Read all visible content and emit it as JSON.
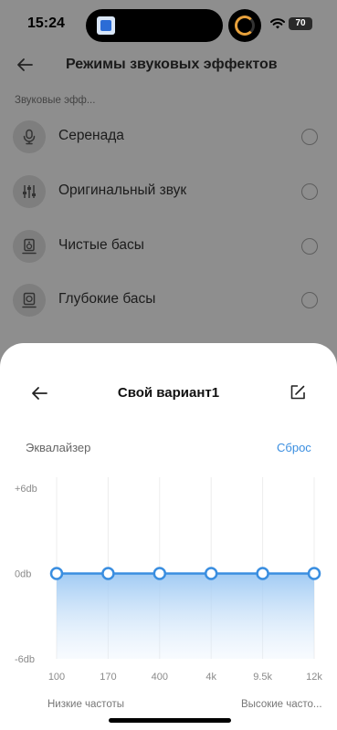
{
  "status_bar": {
    "time": "15:24",
    "battery": "70"
  },
  "header": {
    "title": "Режимы звуковых эффектов"
  },
  "section_label": "Звуковые эфф...",
  "modes": [
    {
      "label": "Серенада",
      "icon": "microphone-icon"
    },
    {
      "label": "Оригинальный звук",
      "icon": "sliders-icon"
    },
    {
      "label": "Чистые басы",
      "icon": "speaker-icon"
    },
    {
      "label": "Глубокие басы",
      "icon": "subwoofer-icon"
    }
  ],
  "sheet": {
    "title": "Свой вариант1",
    "eq_label": "Эквалайзер",
    "reset_label": "Сброс"
  },
  "equalizer": {
    "y_labels": [
      "+6db",
      "0db",
      "-6db"
    ],
    "bands": [
      {
        "freq": "100",
        "gain_db": 0
      },
      {
        "freq": "170",
        "gain_db": 0
      },
      {
        "freq": "400",
        "gain_db": 0
      },
      {
        "freq": "4k",
        "gain_db": 0
      },
      {
        "freq": "9.5k",
        "gain_db": 0
      },
      {
        "freq": "12k",
        "gain_db": 0
      }
    ],
    "range_db": [
      -6,
      6
    ],
    "low_label": "Низкие частоты",
    "high_label": "Высокие часто...",
    "line_color": "#3a8ee0"
  }
}
